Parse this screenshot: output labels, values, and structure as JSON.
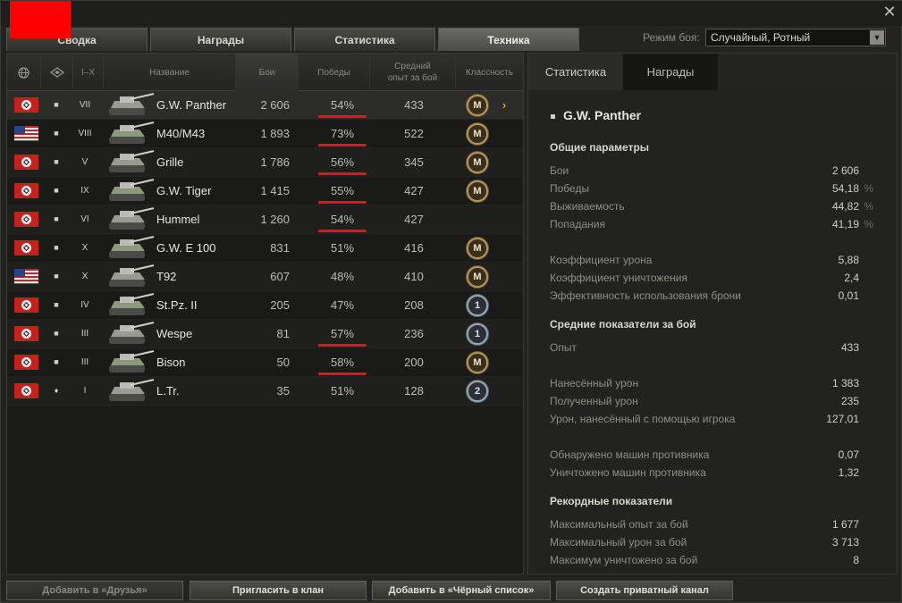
{
  "tabs": [
    "Сводка",
    "Награды",
    "Статистика",
    "Техника"
  ],
  "battle_mode": {
    "label": "Режим боя:",
    "value": "Случайный, Ротный"
  },
  "close_glyph": "✕",
  "table": {
    "headers": {
      "tier": "I–X",
      "name": "Название",
      "battles": "Бои",
      "wins": "Победы",
      "avg_exp": "Средний опыт за бой",
      "mastery": "Классность"
    },
    "rows": [
      {
        "nation": "germany",
        "type": "■",
        "tier": "VII",
        "name": "G.W. Panther",
        "battles": "2 606",
        "wins": "54%",
        "avg_exp": "433",
        "badge": "M",
        "badge_kind": "mastery",
        "selected": true,
        "marked": true
      },
      {
        "nation": "usa",
        "type": "■",
        "tier": "VIII",
        "name": "M40/M43",
        "battles": "1 893",
        "wins": "73%",
        "avg_exp": "522",
        "badge": "M",
        "badge_kind": "mastery",
        "selected": false,
        "marked": true
      },
      {
        "nation": "germany",
        "type": "■",
        "tier": "V",
        "name": "Grille",
        "battles": "1 786",
        "wins": "56%",
        "avg_exp": "345",
        "badge": "M",
        "badge_kind": "mastery",
        "selected": false,
        "marked": true
      },
      {
        "nation": "germany",
        "type": "■",
        "tier": "IX",
        "name": "G.W. Tiger",
        "battles": "1 415",
        "wins": "55%",
        "avg_exp": "427",
        "badge": "M",
        "badge_kind": "mastery",
        "selected": false,
        "marked": true
      },
      {
        "nation": "germany",
        "type": "■",
        "tier": "VI",
        "name": "Hummel",
        "battles": "1 260",
        "wins": "54%",
        "avg_exp": "427",
        "badge": "",
        "badge_kind": "none",
        "selected": false,
        "marked": true
      },
      {
        "nation": "germany",
        "type": "■",
        "tier": "X",
        "name": "G.W. E 100",
        "battles": "831",
        "wins": "51%",
        "avg_exp": "416",
        "badge": "M",
        "badge_kind": "mastery",
        "selected": false,
        "marked": false
      },
      {
        "nation": "usa",
        "type": "■",
        "tier": "X",
        "name": "T92",
        "battles": "607",
        "wins": "48%",
        "avg_exp": "410",
        "badge": "M",
        "badge_kind": "mastery",
        "selected": false,
        "marked": false
      },
      {
        "nation": "germany",
        "type": "■",
        "tier": "IV",
        "name": "St.Pz. II",
        "battles": "205",
        "wins": "47%",
        "avg_exp": "208",
        "badge": "1",
        "badge_kind": "level",
        "selected": false,
        "marked": false
      },
      {
        "nation": "germany",
        "type": "■",
        "tier": "III",
        "name": "Wespe",
        "battles": "81",
        "wins": "57%",
        "avg_exp": "236",
        "badge": "1",
        "badge_kind": "level",
        "selected": false,
        "marked": true
      },
      {
        "nation": "germany",
        "type": "■",
        "tier": "III",
        "name": "Bison",
        "battles": "50",
        "wins": "58%",
        "avg_exp": "200",
        "badge": "M",
        "badge_kind": "mastery",
        "selected": false,
        "marked": true
      },
      {
        "nation": "germany",
        "type": "♦",
        "tier": "I",
        "name": "L.Tr.",
        "battles": "35",
        "wins": "51%",
        "avg_exp": "128",
        "badge": "2",
        "badge_kind": "level",
        "selected": false,
        "marked": false
      }
    ]
  },
  "details": {
    "tabs": [
      "Статистика",
      "Награды"
    ],
    "vehicle": "G.W. Panther",
    "sections": [
      {
        "title": "Общие параметры",
        "stats": [
          {
            "label": "Бои",
            "value": "2 606",
            "unit": ""
          },
          {
            "label": "Победы",
            "value": "54,18",
            "unit": "%"
          },
          {
            "label": "Выживаемость",
            "value": "44,82",
            "unit": "%"
          },
          {
            "label": "Попадания",
            "value": "41,19",
            "unit": "%"
          },
          {
            "label": "",
            "value": "",
            "unit": ""
          },
          {
            "label": "Коэффициент урона",
            "value": "5,88",
            "unit": ""
          },
          {
            "label": "Коэффициент уничтожения",
            "value": "2,4",
            "unit": ""
          },
          {
            "label": "Эффективность использования брони",
            "value": "0,01",
            "unit": ""
          }
        ]
      },
      {
        "title": "Средние показатели за бой",
        "stats": [
          {
            "label": "Опыт",
            "value": "433",
            "unit": ""
          },
          {
            "label": "",
            "value": "",
            "unit": ""
          },
          {
            "label": "Нанесённый урон",
            "value": "1 383",
            "unit": ""
          },
          {
            "label": "Полученный урон",
            "value": "235",
            "unit": ""
          },
          {
            "label": "Урон, нанесённый с помощью игрока",
            "value": "127,01",
            "unit": ""
          },
          {
            "label": "",
            "value": "",
            "unit": ""
          },
          {
            "label": "Обнаружено машин противника",
            "value": "0,07",
            "unit": ""
          },
          {
            "label": "Уничтожено машин противника",
            "value": "1,32",
            "unit": ""
          }
        ]
      },
      {
        "title": "Рекордные показатели",
        "stats": [
          {
            "label": "Максимальный опыт за бой",
            "value": "1 677",
            "unit": ""
          },
          {
            "label": "Максимальный урон за бой",
            "value": "3 713",
            "unit": ""
          },
          {
            "label": "Максимум уничтожено за бой",
            "value": "8",
            "unit": ""
          }
        ]
      }
    ]
  },
  "bottom_buttons": [
    {
      "label": "Добавить в «Друзья»",
      "disabled": true
    },
    {
      "label": "Пригласить в клан",
      "disabled": false
    },
    {
      "label": "Добавить в «Чёрный список»",
      "disabled": false
    },
    {
      "label": "Создать приватный канал",
      "disabled": false
    }
  ],
  "colors": {
    "accent_gold": "#e0a020",
    "underline_red": "#e8141a",
    "redaction": "#ff0000"
  },
  "icons": {
    "globe": "globe-icon",
    "type_filter": "vehicle-type-icon",
    "close": "close-icon",
    "chevron": "chevron-right-icon",
    "dropdown": "chevron-down-icon"
  }
}
